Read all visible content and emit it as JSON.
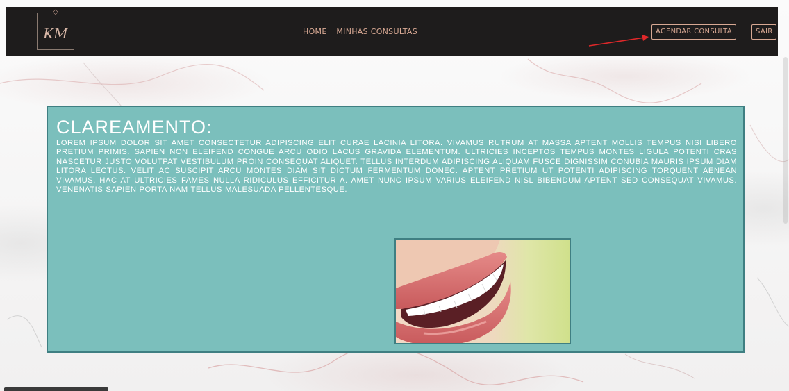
{
  "nav": {
    "logo_text": "KM",
    "links": [
      "HOME",
      "MINHAS CONSULTAS"
    ],
    "schedule_label": "AGENDAR CONSULTA",
    "logout_label": "SAIR"
  },
  "content": {
    "title": "CLAREAMENTO:",
    "body": "LOREM IPSUM DOLOR SIT AMET CONSECTETUR ADIPISCING ELIT CURAE LACINIA LITORA. VIVAMUS RUTRUM AT MASSA APTENT MOLLIS TEMPUS NISI LIBERO PRETIUM PRIMIS. SAPIEN NON ELEIFEND CONGUE ARCU ODIO LACUS GRAVIDA ELEMENTUM. ULTRICIES INCEPTOS TEMPUS MONTES LIGULA POTENTI CRAS NASCETUR JUSTO VOLUTPAT VESTIBULUM PROIN CONSEQUAT ALIQUET. TELLUS INTERDUM ADIPISCING ALIQUAM FUSCE DIGNISSIM CONUBIA MAURIS IPSUM DIAM LITORA LECTUS. VELIT AC SUSCIPIT ARCU MONTES DIAM SIT DICTUM FERMENTUM DONEC. APTENT PRETIUM UT POTENTI ADIPISCING TORQUENT AENEAN VIVAMUS. HAC AT ULTRICIES FAMES NULLA RIDICULUS EFFICITUR A. AMET NUNC IPSUM VARIUS ELEIFEND NISL BIBENDUM APTENT SED CONSEQUAT VIVAMUS. VENENATIS SAPIEN PORTA NAM TELLUS MALESUADA PELLENTESQUE."
  },
  "colors": {
    "navbar": "#1e1c1c",
    "accent": "#d8a893",
    "card": "#7bbfbc",
    "card_border": "#3f7f82",
    "arrow": "#e0282a"
  },
  "icons": {
    "logo_gem": "diamond-icon"
  }
}
